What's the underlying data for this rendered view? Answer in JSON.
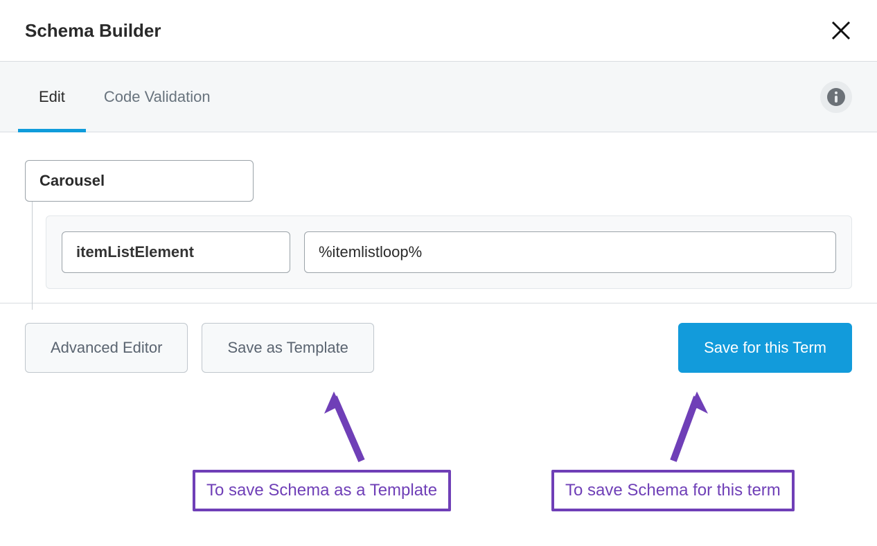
{
  "header": {
    "title": "Schema Builder"
  },
  "tabs": {
    "edit": "Edit",
    "code_validation": "Code Validation"
  },
  "schema": {
    "root_label": "Carousel",
    "child_key": "itemListElement",
    "child_value": "%itemlistloop%"
  },
  "buttons": {
    "advanced_editor": "Advanced Editor",
    "save_template": "Save as Template",
    "save_term": "Save for this Term"
  },
  "annotations": {
    "template": "To save Schema as a Template",
    "term": "To save Schema for this term"
  }
}
